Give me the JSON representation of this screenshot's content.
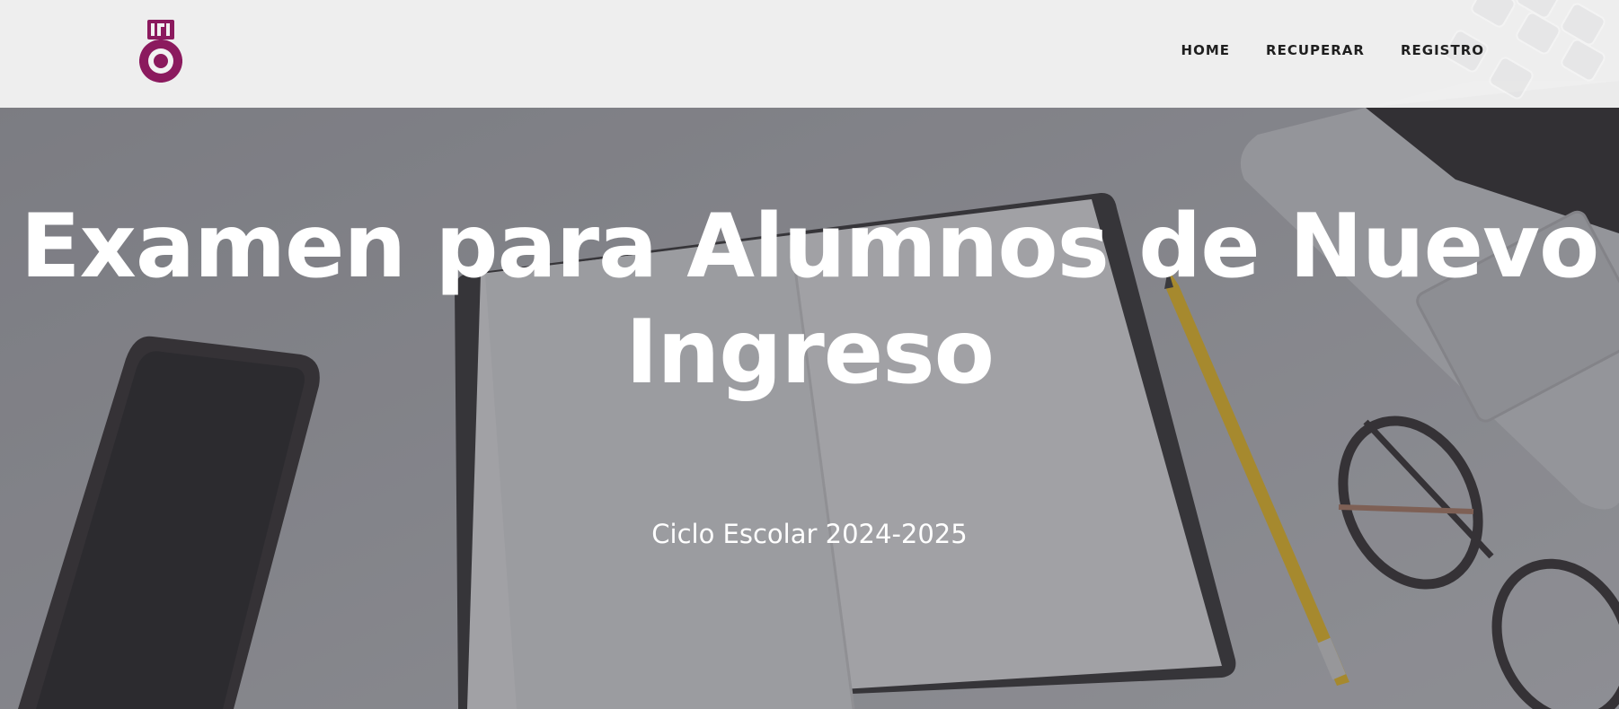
{
  "header": {
    "logo_alt": "IPN",
    "nav": [
      {
        "label": "HOME"
      },
      {
        "label": "RECUPERAR"
      },
      {
        "label": "REGISTRO"
      }
    ]
  },
  "hero": {
    "title": "Examen para Alumnos de Nuevo Ingreso",
    "subtitle": "Ciclo Escolar 2024-2025"
  },
  "colors": {
    "header_bg": "#f2f2f2",
    "logo": "#8b1a5e",
    "nav_text": "#1f1f1f",
    "hero_text": "#ffffff"
  }
}
